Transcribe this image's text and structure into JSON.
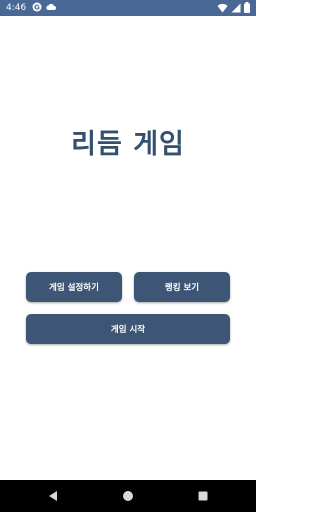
{
  "status_bar": {
    "time": "4:46",
    "icons_left": [
      "sync-icon",
      "cloud-icon"
    ],
    "icons_right": [
      "wifi-icon",
      "signal-icon",
      "battery-icon"
    ],
    "color": "#4a6896"
  },
  "app": {
    "title": "리듬 게임"
  },
  "buttons": {
    "settings_label": "게임 설정하기",
    "ranking_label": "랭킹 보기",
    "start_label": "게임 시작",
    "color": "#3e5675"
  },
  "nav_bar": {
    "icons": [
      "back-icon",
      "home-icon",
      "recent-apps-icon"
    ]
  }
}
